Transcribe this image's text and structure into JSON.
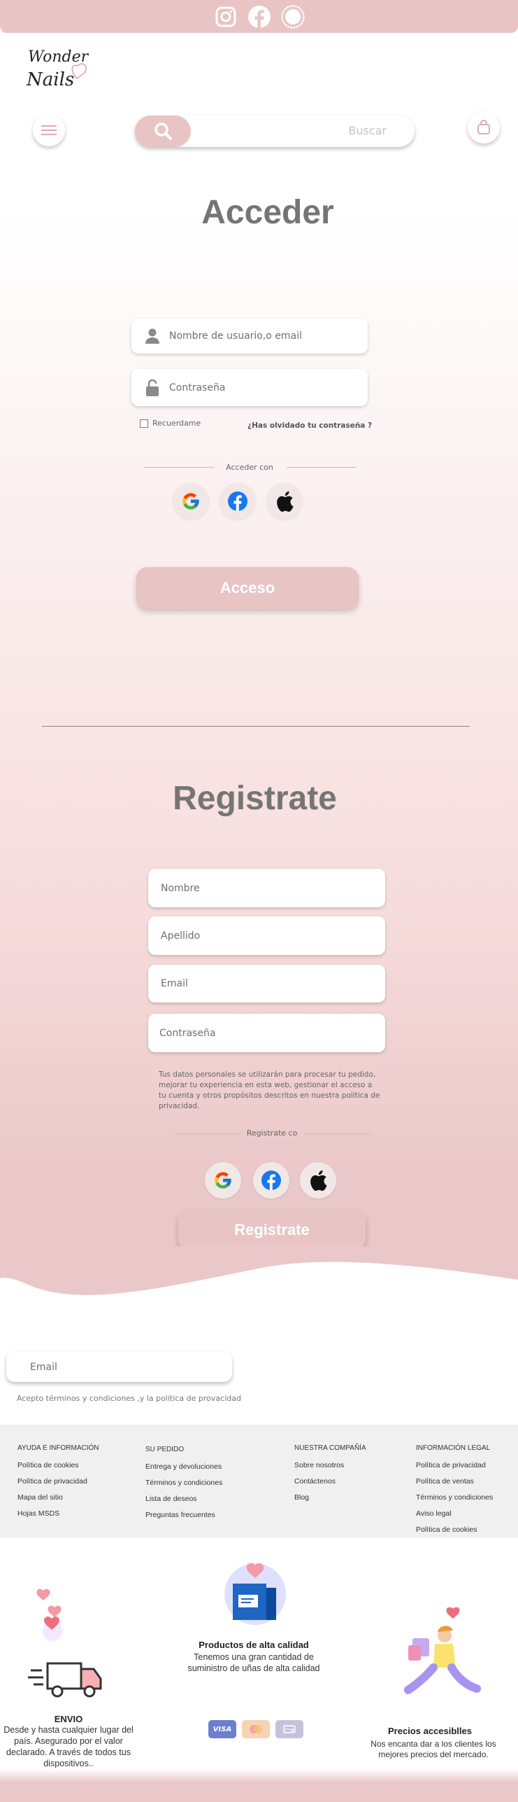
{
  "header": {
    "social": [
      "instagram-icon",
      "facebook-icon",
      "snapchat-icon"
    ],
    "logo_text": "Wonder Nails",
    "search": {
      "placeholder": "Buscar"
    }
  },
  "login": {
    "title": "Acceder",
    "username_placeholder": "Nombre de usuario,o email",
    "password_placeholder": "Contraseña",
    "remember_label": "Recuerdame",
    "forgot_link": "¿Has olvidado tu contraseña ?",
    "social_divider": "Acceder con",
    "submit_label": "Acceso"
  },
  "register": {
    "title": "Registrate",
    "first_name_placeholder": "Nombre",
    "last_name_placeholder": "Apellido",
    "email_placeholder": "Email",
    "password_placeholder": "Contraseña",
    "privacy_text": "Tus datos personales se utilizarán para procesar tu pedido, mejorar tu experiencia en esta web, gestionar el acceso a tu cuenta y otros propósitos descritos en nuestra política de privacidad.",
    "social_divider": "Registrate co",
    "submit_label": "Registrate"
  },
  "newsletter": {
    "email_placeholder": "Email",
    "terms_text": "Acepto términos y condiciones ,y la política de provacidad"
  },
  "footer": {
    "columns": [
      {
        "title": "AYUDA E INFORMACIÓN",
        "links": [
          "Política de cookies",
          "Política de privacidad",
          "Mapa del sitio",
          "Hojas MSDS"
        ]
      },
      {
        "title": "SU PEDIDO",
        "links": [
          "Entrega y devoluciones",
          "Términos y condiciones",
          "Lista de deseos",
          "Preguntas frecuentes"
        ]
      },
      {
        "title": "NUESTRA COMPAÑÍA",
        "links": [
          "Sobre nosotros",
          "Contáctenos",
          "Blog"
        ]
      },
      {
        "title": "INFORMACIÓN LEGAL",
        "links": [
          "Política de privacidad",
          "Política de ventas",
          "Términos y condiciones",
          "Aviso legal",
          "Política de cookies"
        ]
      }
    ]
  },
  "features": {
    "shipping": {
      "title": "ENVIO",
      "text": "Desde y hasta cualquier lugar del país. Asegurado por el valor declarado. A través de todos tus dispositivos.."
    },
    "quality": {
      "title": "Productos de alta calidad",
      "text": "Tenemos una gran cantidad de suministro de uñas de alta calidad"
    },
    "price": {
      "title": "Precios accesiblles",
      "text": "Nos encanta dar a los clientes los mejores precios del mercado."
    },
    "cards": [
      "VISA",
      "mastercard-icon",
      "card-icon"
    ]
  },
  "colors": {
    "accent": "#e8c4c5",
    "title_gray": "#757575"
  }
}
